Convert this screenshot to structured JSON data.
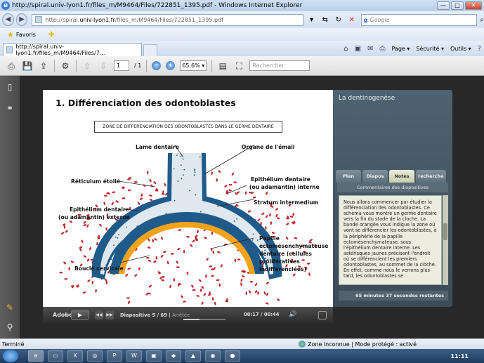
{
  "window": {
    "title": "http://spiral.univ-lyon1.fr/files_m/M9464/Files/722851_1395.pdf - Windows Internet Explorer",
    "min": "—",
    "max": "□",
    "close": "✕"
  },
  "address": {
    "url_prefix": "http://spiral.",
    "url_domain": "univ-lyon1.fr",
    "url_rest": "/files_m/M9464/Files/722851_1395.pdf",
    "search_placeholder": "Google"
  },
  "favorites": {
    "label": "Favoris"
  },
  "tab": {
    "label": "http://spiral.univ-lyon1.fr/files_m/M9464/Files/7..."
  },
  "commands": {
    "page": "Page ▾",
    "security": "Sécurité ▾",
    "tools": "Outils ▾"
  },
  "pdf_toolbar": {
    "page_current": "1",
    "page_total": "/ 1",
    "zoom": "65,6% ▾",
    "find_placeholder": "Rechercher"
  },
  "slide": {
    "title": "1. Différenciation des odontoblastes",
    "zone_caption": "ZONE DE DIFFERENCIATION DES ODONTOBLASTES DANS LE GERME DENTAIRE",
    "labels": {
      "lame": "Lame dentaire",
      "organe": "Organe de l'émail",
      "reticulum": "Réticulum étoilé",
      "epi_interne_1": "Epithélium dentaire",
      "epi_interne_2": "(ou adamantin) interne",
      "epi_externe_1": "Epithélium dentaire",
      "epi_externe_2": "(ou adamantin) externe",
      "stratum": "Stratum intermedium",
      "papille_1": "Papille",
      "papille_2": "ectomésenchymateuse",
      "papille_3": "dentaire (cellules",
      "papille_4": "prolifératives",
      "papille_5": "indifférenciées)",
      "boucle": "Boucle cervicale"
    }
  },
  "player": {
    "adobe": "Adobe",
    "slide_info": "Diapositive 5 / 69",
    "status": "Arrêtée",
    "time": "00:17 / 00:44",
    "progress": 0.39
  },
  "panel": {
    "title": "La dentinogenèse",
    "tabs": [
      "Plan",
      "Diapos",
      "Notes",
      "recherche"
    ],
    "subtitle": "Commentaires des diapositives",
    "notes": "Nous allons commencer par étudier la différenciation des odontoblastes. Ce schéma vous montre un germe dentaire vers la fin du stade de la cloche. La bande orangée vous indique la zone où vont se différencier les odontoblastes, à la périphérie de la papille ectomésenchymateuse, sous l'épithélium dentaire interne. Les astérisques jaunes précisent l'endroit où se différencient les premiers odontoblastes, au sommet de la cloche. En effet, comme nous le verrons plus tard, les odontoblastes se",
    "duration": "65 minutes 37 secondes restantes"
  },
  "statusbar": {
    "left": "Terminé",
    "zone": "Zone inconnue | Mode protégé : activé"
  },
  "taskbar": {
    "clock": "11:11"
  },
  "colors": {
    "accent": "#3b4c58",
    "papilla_dots": "#c0262c",
    "orange_band": "#f4a21a",
    "epithelium": "#1f5b8a"
  }
}
